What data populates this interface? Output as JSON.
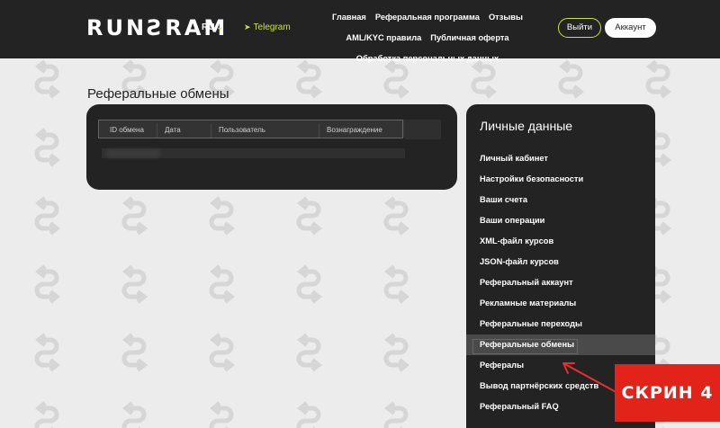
{
  "header": {
    "logo": "RUNƧRAM",
    "lang": "RU",
    "telegram": "Telegram",
    "nav": [
      "Главная",
      "Реферальная программа",
      "Отзывы",
      "AML/KYC правила",
      "Публичная оферта",
      "Обработка персональных данных"
    ],
    "logout": "Выйти",
    "account": "Аккаунт"
  },
  "main": {
    "title": "Реферальные обмены",
    "table": {
      "columns": [
        "ID обмена",
        "Дата",
        "Пользователь",
        "Вознаграждение"
      ]
    }
  },
  "sidebar": {
    "title": "Личные данные",
    "items": [
      "Личный кабинет",
      "Настройки безопасности",
      "Ваши счета",
      "Ваши операции",
      "XML-файл курсов",
      "JSON-файл курсов",
      "Реферальный аккаунт",
      "Рекламные материалы",
      "Реферальные переходы",
      "Реферальные обмены",
      "Рефералы",
      "Вывод партнёрских средств",
      "Реферальный FAQ"
    ],
    "active_index": 9
  },
  "annotation": {
    "badge": "СКРИН 4"
  },
  "colors": {
    "accent": "#c8e632",
    "highlight": "#e53030",
    "badge": "#e2231a",
    "dark": "#232323"
  }
}
